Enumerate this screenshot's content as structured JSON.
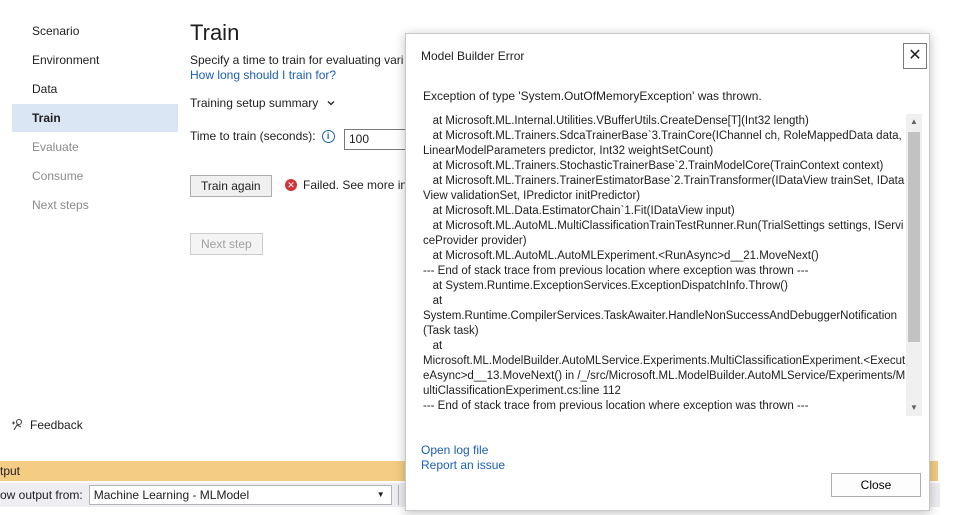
{
  "sidebar": {
    "items": [
      {
        "label": "Scenario"
      },
      {
        "label": "Environment"
      },
      {
        "label": "Data"
      },
      {
        "label": "Train"
      },
      {
        "label": "Evaluate"
      },
      {
        "label": "Consume"
      },
      {
        "label": "Next steps"
      }
    ],
    "feedback_label": "Feedback"
  },
  "main": {
    "title": "Train",
    "description": "Specify a time to train for evaluating vari",
    "how_long_link": "How long should I train for?",
    "summary_label": "Training setup summary",
    "time_label": "Time to train (seconds):",
    "time_value": "100",
    "train_again_label": "Train again",
    "status_text": "Failed. See more in",
    "next_step_label": "Next step"
  },
  "output": {
    "title": "tput",
    "show_from_label": "ow output from:",
    "selected_source": "Machine Learning - MLModel"
  },
  "dialog": {
    "title": "Model Builder Error",
    "close_x": "✕",
    "message": "Exception of type 'System.OutOfMemoryException' was thrown.",
    "stack_trace": "   at Microsoft.ML.Internal.Utilities.VBufferUtils.CreateDense[T](Int32 length)\n   at Microsoft.ML.Trainers.SdcaTrainerBase`3.TrainCore(IChannel ch, RoleMappedData data, LinearModelParameters predictor, Int32 weightSetCount)\n   at Microsoft.ML.Trainers.StochasticTrainerBase`2.TrainModelCore(TrainContext context)\n   at Microsoft.ML.Trainers.TrainerEstimatorBase`2.TrainTransformer(IDataView trainSet, IDataView validationSet, IPredictor initPredictor)\n   at Microsoft.ML.Data.EstimatorChain`1.Fit(IDataView input)\n   at Microsoft.ML.AutoML.MultiClassificationTrainTestRunner.Run(TrialSettings settings, IServiceProvider provider)\n   at Microsoft.ML.AutoML.AutoMLExperiment.<RunAsync>d__21.MoveNext()\n--- End of stack trace from previous location where exception was thrown ---\n   at System.Runtime.ExceptionServices.ExceptionDispatchInfo.Throw()\n   at\nSystem.Runtime.CompilerServices.TaskAwaiter.HandleNonSuccessAndDebuggerNotification(Task task)\n   at\nMicrosoft.ML.ModelBuilder.AutoMLService.Experiments.MultiClassificationExperiment.<ExecuteAsync>d__13.MoveNext() in /_/src/Microsoft.ML.ModelBuilder.AutoMLService/Experiments/MultiClassificationExperiment.cs:line 112\n--- End of stack trace from previous location where exception was thrown ---",
    "open_log_link": "Open log file",
    "report_issue_link": "Report an issue",
    "close_button": "Close"
  }
}
